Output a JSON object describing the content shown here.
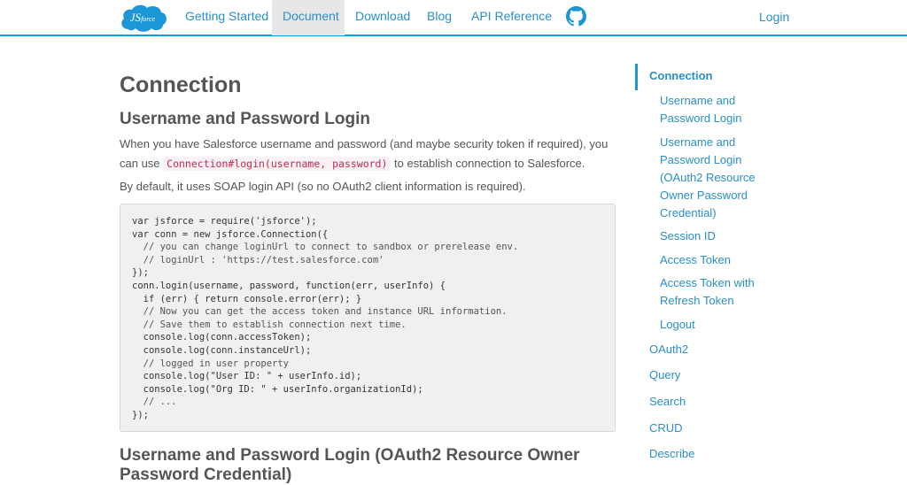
{
  "header": {
    "logo_text": "JSforce",
    "nav": [
      {
        "label": "Getting Started"
      },
      {
        "label": "Document"
      },
      {
        "label": "Download"
      },
      {
        "label": "Blog"
      },
      {
        "label": "API Reference"
      }
    ],
    "login_label": "Login"
  },
  "main": {
    "page_title": "Connection",
    "section1_title": "Username and Password Login",
    "para1_a": "When you have Salesforce username and password (and maybe security token if required), you can use ",
    "para1_code": "Connection#login(username, password)",
    "para1_b": " to establish connection to Salesforce.",
    "para2": "By default, it uses SOAP login API (so no OAuth2 client information is required).",
    "code_lines": [
      "var jsforce = require('jsforce');",
      "var conn = new jsforce.Connection({",
      "  // you can change loginUrl to connect to sandbox or prerelease env.",
      "  // loginUrl : 'https://test.salesforce.com'",
      "});",
      "conn.login(username, password, function(err, userInfo) {",
      "  if (err) { return console.error(err); }",
      "  // Now you can get the access token and instance URL information.",
      "  // Save them to establish connection next time.",
      "  console.log(conn.accessToken);",
      "  console.log(conn.instanceUrl);",
      "  // logged in user property",
      "  console.log(\"User ID: \" + userInfo.id);",
      "  console.log(\"Org ID: \" + userInfo.organizationId);",
      "  // ...",
      "});"
    ],
    "section2_title": "Username and Password Login (OAuth2 Resource Owner Password Credential)"
  },
  "sidebar": {
    "items": [
      {
        "label": "Connection"
      },
      {
        "label": "Username and Password Login"
      },
      {
        "label": "Username and Password Login (OAuth2 Resource Owner Password Credential)"
      },
      {
        "label": "Session ID"
      },
      {
        "label": "Access Token"
      },
      {
        "label": "Access Token with Refresh Token"
      },
      {
        "label": "Logout"
      },
      {
        "label": "OAuth2"
      },
      {
        "label": "Query"
      },
      {
        "label": "Search"
      },
      {
        "label": "CRUD"
      },
      {
        "label": "Describe"
      }
    ]
  },
  "colors": {
    "accent": "#1b96d6",
    "link": "#2a8fc6",
    "text": "#555555",
    "code_bg": "#f0f0f0",
    "inline_code": "#c7254e"
  }
}
